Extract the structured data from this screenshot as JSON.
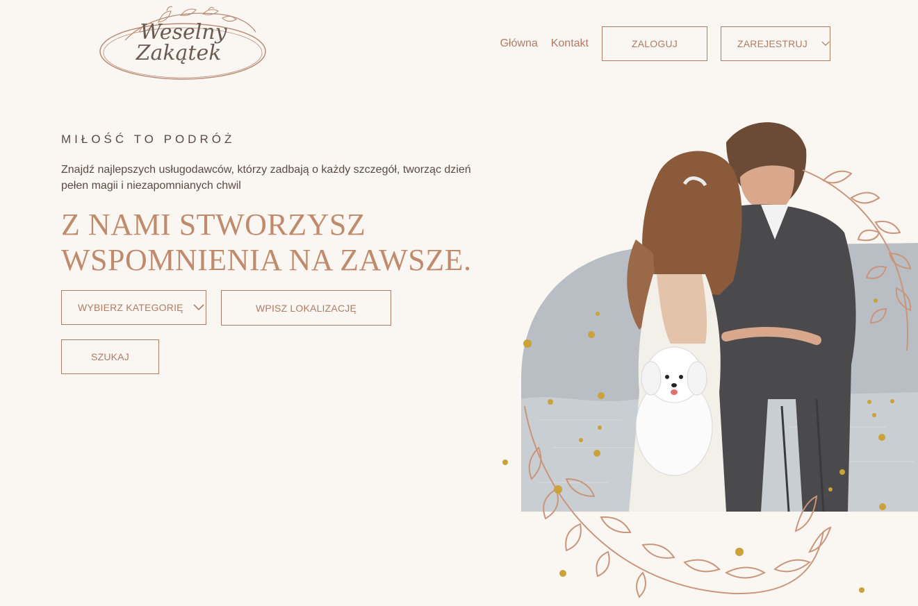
{
  "logo": {
    "line1": "Weselny",
    "line2": "Zakątek"
  },
  "nav": {
    "home": "Główna",
    "contact": "Kontakt",
    "login": "ZALOGUJ",
    "register": "ZAREJESTRUJ"
  },
  "hero": {
    "tagline": "MIŁOŚĆ TO PODRÓŻ",
    "lead": "Znajdź najlepszych usługodawców, którzy zadbają o każdy szczegół, tworząc dzień pełen magii i niezapomnianych chwil",
    "headline_line1": "Z NAMI STWORZYSZ",
    "headline_line2": "WSPOMNIENIA NA ZAWSZE."
  },
  "search": {
    "category": "WYBIERZ KATEGORIĘ",
    "location": "WPISZ LOKALIZACJĘ",
    "submit": "SZUKAJ"
  },
  "colors": {
    "background": "#faf7f2",
    "accent": "#b07c63",
    "heading": "#c08a6c",
    "text": "#5b4a44"
  },
  "icons": [
    "chevron-down-icon",
    "laurel-wreath-icon"
  ]
}
